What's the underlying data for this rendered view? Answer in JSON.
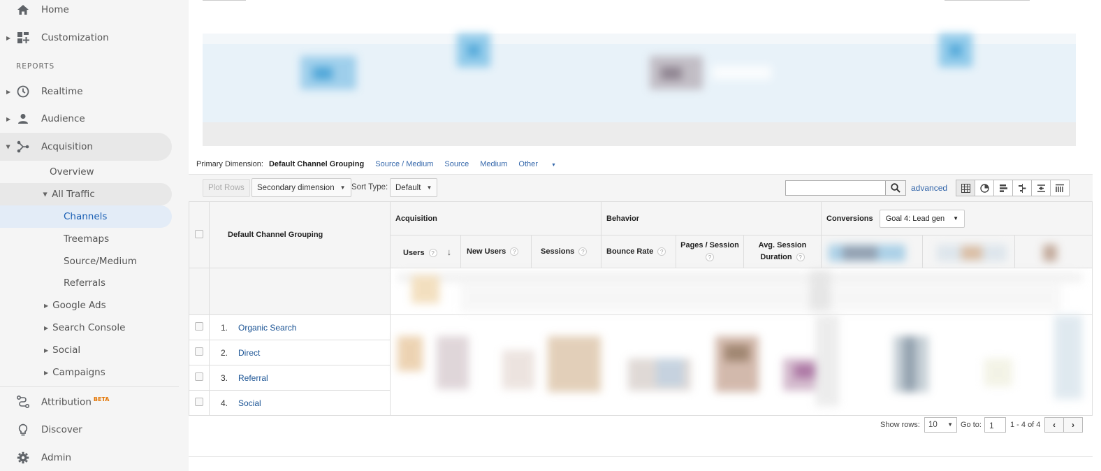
{
  "sidebar": {
    "home": "Home",
    "customization": "Customization",
    "reports_header": "REPORTS",
    "realtime": "Realtime",
    "audience": "Audience",
    "acquisition": "Acquisition",
    "overview": "Overview",
    "all_traffic": "All Traffic",
    "channels": "Channels",
    "treemaps": "Treemaps",
    "source_medium": "Source/Medium",
    "referrals": "Referrals",
    "google_ads": "Google Ads",
    "search_console": "Search Console",
    "social": "Social",
    "campaigns": "Campaigns",
    "attribution": "Attribution",
    "attribution_badge": "BETA",
    "discover": "Discover",
    "admin": "Admin"
  },
  "primary_dimension": {
    "label": "Primary Dimension:",
    "current": "Default Channel Grouping",
    "options": [
      "Source / Medium",
      "Source",
      "Medium"
    ],
    "other": "Other"
  },
  "toolbar": {
    "plot_rows": "Plot Rows",
    "secondary_dimension": "Secondary dimension",
    "sort_type_label": "Sort Type:",
    "sort_type_value": "Default",
    "search_value": "",
    "advanced": "advanced"
  },
  "table": {
    "dimension_header": "Default Channel Grouping",
    "groups": {
      "acquisition": "Acquisition",
      "behavior": "Behavior",
      "conversions": "Conversions",
      "goal_select": "Goal 4: Lead gen"
    },
    "columns": {
      "users": "Users",
      "new_users": "New Users",
      "sessions": "Sessions",
      "bounce_rate": "Bounce Rate",
      "pages_session": "Pages / Session",
      "avg_session_1": "Avg. Session",
      "avg_session_2": "Duration"
    },
    "help": "?",
    "rows": [
      {
        "num": "1.",
        "label": "Organic Search"
      },
      {
        "num": "2.",
        "label": "Direct"
      },
      {
        "num": "3.",
        "label": "Referral"
      },
      {
        "num": "4.",
        "label": "Social"
      }
    ]
  },
  "footer": {
    "show_rows_label": "Show rows:",
    "show_rows_value": "10",
    "goto_label": "Go to:",
    "goto_value": "1",
    "range": "1 - 4 of 4"
  },
  "colors": {
    "accent_blue": "#1a73e8",
    "link": "#3366aa",
    "active_nav_bg": "#e3ecf7"
  }
}
